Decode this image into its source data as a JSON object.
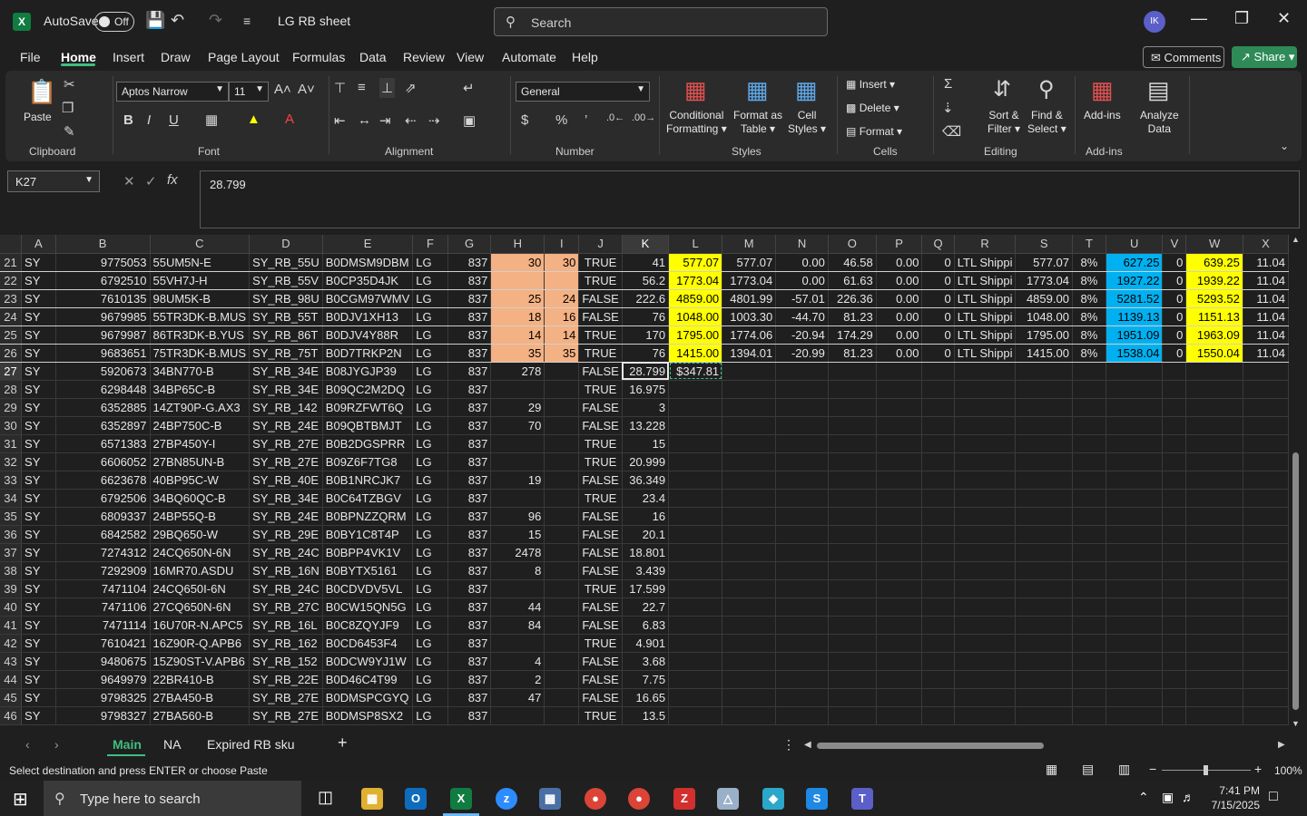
{
  "titlebar": {
    "autosave_label": "AutoSave",
    "autosave_state": "Off",
    "doc_title": "LG RB sheet",
    "search_placeholder": "Search",
    "avatar_initials": "IK"
  },
  "ribbon_tabs": [
    "File",
    "Home",
    "Insert",
    "Draw",
    "Page Layout",
    "Formulas",
    "Data",
    "Review",
    "View",
    "Automate",
    "Help"
  ],
  "active_tab": "Home",
  "buttons": {
    "comments": "Comments",
    "share": "Share"
  },
  "ribbon": {
    "clipboard": {
      "label": "Clipboard",
      "paste": "Paste"
    },
    "font": {
      "label": "Font",
      "family": "Aptos Narrow",
      "size": "11"
    },
    "alignment": {
      "label": "Alignment"
    },
    "number": {
      "label": "Number",
      "format": "General"
    },
    "styles": {
      "label": "Styles",
      "conditional": "Conditional",
      "conditional2": "Formatting",
      "format_as": "Format as",
      "format_as2": "Table",
      "cell": "Cell",
      "cell2": "Styles"
    },
    "cells": {
      "label": "Cells",
      "insert": "Insert",
      "delete": "Delete",
      "format": "Format"
    },
    "editing": {
      "label": "Editing",
      "sort": "Sort &",
      "sort2": "Filter",
      "find": "Find &",
      "find2": "Select"
    },
    "addins": {
      "label": "Add-ins",
      "addins": "Add-ins",
      "analyze": "Analyze",
      "analyze2": "Data"
    }
  },
  "formula_bar": {
    "name_box": "K27",
    "formula": "28.799"
  },
  "columns": [
    "A",
    "B",
    "C",
    "D",
    "E",
    "F",
    "G",
    "H",
    "I",
    "J",
    "K",
    "L",
    "M",
    "N",
    "O",
    "P",
    "Q",
    "R",
    "S",
    "T",
    "U",
    "V",
    "W",
    "X"
  ],
  "rows": [
    {
      "n": "21",
      "c": [
        "SY",
        "9775053",
        "55UM5N-E",
        "SY_RB_55U",
        "B0DMSM9DBM",
        "LG",
        "837",
        "30",
        "30",
        "TRUE",
        "41",
        "577.07",
        "577.07",
        "0.00",
        "46.58",
        "0.00",
        "0",
        "LTL Shippi",
        "577.07",
        "8%",
        "627.25",
        "0",
        "639.25",
        "11.04"
      ]
    },
    {
      "n": "22",
      "c": [
        "SY",
        "6792510",
        "55VH7J-H",
        "SY_RB_55V",
        "B0CP35D4JK",
        "LG",
        "837",
        "",
        "",
        "TRUE",
        "56.2",
        "1773.04",
        "1773.04",
        "0.00",
        "61.63",
        "0.00",
        "0",
        "LTL Shippi",
        "1773.04",
        "8%",
        "1927.22",
        "0",
        "1939.22",
        "11.04"
      ]
    },
    {
      "n": "23",
      "c": [
        "SY",
        "7610135",
        "98UM5K-B",
        "SY_RB_98U",
        "B0CGM97WMV",
        "LG",
        "837",
        "25",
        "24",
        "FALSE",
        "222.6",
        "4859.00",
        "4801.99",
        "-57.01",
        "226.36",
        "0.00",
        "0",
        "LTL Shippi",
        "4859.00",
        "8%",
        "5281.52",
        "0",
        "5293.52",
        "11.04"
      ]
    },
    {
      "n": "24",
      "c": [
        "SY",
        "9679985",
        "55TR3DK-B.MUS",
        "SY_RB_55T",
        "B0DJV1XH13",
        "LG",
        "837",
        "18",
        "16",
        "FALSE",
        "76",
        "1048.00",
        "1003.30",
        "-44.70",
        "81.23",
        "0.00",
        "0",
        "LTL Shippi",
        "1048.00",
        "8%",
        "1139.13",
        "0",
        "1151.13",
        "11.04"
      ]
    },
    {
      "n": "25",
      "c": [
        "SY",
        "9679987",
        "86TR3DK-B.YUS",
        "SY_RB_86T",
        "B0DJV4Y88R",
        "LG",
        "837",
        "14",
        "14",
        "TRUE",
        "170",
        "1795.00",
        "1774.06",
        "-20.94",
        "174.29",
        "0.00",
        "0",
        "LTL Shippi",
        "1795.00",
        "8%",
        "1951.09",
        "0",
        "1963.09",
        "11.04"
      ]
    },
    {
      "n": "26",
      "c": [
        "SY",
        "9683651",
        "75TR3DK-B.MUS",
        "SY_RB_75T",
        "B0D7TRKP2N",
        "LG",
        "837",
        "35",
        "35",
        "TRUE",
        "76",
        "1415.00",
        "1394.01",
        "-20.99",
        "81.23",
        "0.00",
        "0",
        "LTL Shippi",
        "1415.00",
        "8%",
        "1538.04",
        "0",
        "1550.04",
        "11.04"
      ]
    },
    {
      "n": "27",
      "c": [
        "SY",
        "5920673",
        "34BN770-B",
        "SY_RB_34E",
        "B08JYGJP39",
        "LG",
        "837",
        "278",
        "",
        "FALSE",
        "28.799",
        "$347.81",
        "",
        "",
        "",
        "",
        "",
        "",
        "",
        "",
        "",
        "",
        "",
        ""
      ]
    },
    {
      "n": "28",
      "c": [
        "SY",
        "6298448",
        "34BP65C-B",
        "SY_RB_34E",
        "B09QC2M2DQ",
        "LG",
        "837",
        "",
        "",
        "TRUE",
        "16.975",
        "",
        "",
        "",
        "",
        "",
        "",
        "",
        "",
        "",
        "",
        "",
        "",
        ""
      ]
    },
    {
      "n": "29",
      "c": [
        "SY",
        "6352885",
        "14ZT90P-G.AX3",
        "SY_RB_142",
        "B09RZFWT6Q",
        "LG",
        "837",
        "29",
        "",
        "FALSE",
        "3",
        "",
        "",
        "",
        "",
        "",
        "",
        "",
        "",
        "",
        "",
        "",
        "",
        ""
      ]
    },
    {
      "n": "30",
      "c": [
        "SY",
        "6352897",
        "24BP750C-B",
        "SY_RB_24E",
        "B09QBTBMJT",
        "LG",
        "837",
        "70",
        "",
        "FALSE",
        "13.228",
        "",
        "",
        "",
        "",
        "",
        "",
        "",
        "",
        "",
        "",
        "",
        "",
        ""
      ]
    },
    {
      "n": "31",
      "c": [
        "SY",
        "6571383",
        "27BP450Y-I",
        "SY_RB_27E",
        "B0B2DGSPRR",
        "LG",
        "837",
        "",
        "",
        "TRUE",
        "15",
        "",
        "",
        "",
        "",
        "",
        "",
        "",
        "",
        "",
        "",
        "",
        "",
        ""
      ]
    },
    {
      "n": "32",
      "c": [
        "SY",
        "6606052",
        "27BN85UN-B",
        "SY_RB_27E",
        "B09Z6F7TG8",
        "LG",
        "837",
        "",
        "",
        "TRUE",
        "20.999",
        "",
        "",
        "",
        "",
        "",
        "",
        "",
        "",
        "",
        "",
        "",
        "",
        ""
      ]
    },
    {
      "n": "33",
      "c": [
        "SY",
        "6623678",
        "40BP95C-W",
        "SY_RB_40E",
        "B0B1NRCJK7",
        "LG",
        "837",
        "19",
        "",
        "FALSE",
        "36.349",
        "",
        "",
        "",
        "",
        "",
        "",
        "",
        "",
        "",
        "",
        "",
        "",
        ""
      ]
    },
    {
      "n": "34",
      "c": [
        "SY",
        "6792506",
        "34BQ60QC-B",
        "SY_RB_34E",
        "B0C64TZBGV",
        "LG",
        "837",
        "",
        "",
        "TRUE",
        "23.4",
        "",
        "",
        "",
        "",
        "",
        "",
        "",
        "",
        "",
        "",
        "",
        "",
        ""
      ]
    },
    {
      "n": "35",
      "c": [
        "SY",
        "6809337",
        "24BP55Q-B",
        "SY_RB_24E",
        "B0BPNZZQRM",
        "LG",
        "837",
        "96",
        "",
        "FALSE",
        "16",
        "",
        "",
        "",
        "",
        "",
        "",
        "",
        "",
        "",
        "",
        "",
        "",
        ""
      ]
    },
    {
      "n": "36",
      "c": [
        "SY",
        "6842582",
        "29BQ650-W",
        "SY_RB_29E",
        "B0BY1C8T4P",
        "LG",
        "837",
        "15",
        "",
        "FALSE",
        "20.1",
        "",
        "",
        "",
        "",
        "",
        "",
        "",
        "",
        "",
        "",
        "",
        "",
        ""
      ]
    },
    {
      "n": "37",
      "c": [
        "SY",
        "7274312",
        "24CQ650N-6N",
        "SY_RB_24C",
        "B0BPP4VK1V",
        "LG",
        "837",
        "2478",
        "",
        "FALSE",
        "18.801",
        "",
        "",
        "",
        "",
        "",
        "",
        "",
        "",
        "",
        "",
        "",
        "",
        ""
      ]
    },
    {
      "n": "38",
      "c": [
        "SY",
        "7292909",
        "16MR70.ASDU",
        "SY_RB_16N",
        "B0BYTX5161",
        "LG",
        "837",
        "8",
        "",
        "FALSE",
        "3.439",
        "",
        "",
        "",
        "",
        "",
        "",
        "",
        "",
        "",
        "",
        "",
        "",
        ""
      ]
    },
    {
      "n": "39",
      "c": [
        "SY",
        "7471104",
        "24CQ650I-6N",
        "SY_RB_24C",
        "B0CDVDV5VL",
        "LG",
        "837",
        "",
        "",
        "TRUE",
        "17.599",
        "",
        "",
        "",
        "",
        "",
        "",
        "",
        "",
        "",
        "",
        "",
        "",
        ""
      ]
    },
    {
      "n": "40",
      "c": [
        "SY",
        "7471106",
        "27CQ650N-6N",
        "SY_RB_27C",
        "B0CW15QN5G",
        "LG",
        "837",
        "44",
        "",
        "FALSE",
        "22.7",
        "",
        "",
        "",
        "",
        "",
        "",
        "",
        "",
        "",
        "",
        "",
        "",
        ""
      ]
    },
    {
      "n": "41",
      "c": [
        "SY",
        "7471114",
        "16U70R-N.APC5",
        "SY_RB_16L",
        "B0C8ZQYJF9",
        "LG",
        "837",
        "84",
        "",
        "FALSE",
        "6.83",
        "",
        "",
        "",
        "",
        "",
        "",
        "",
        "",
        "",
        "",
        "",
        "",
        ""
      ]
    },
    {
      "n": "42",
      "c": [
        "SY",
        "7610421",
        "16Z90R-Q.APB6",
        "SY_RB_162",
        "B0CD6453F4",
        "LG",
        "837",
        "",
        "",
        "TRUE",
        "4.901",
        "",
        "",
        "",
        "",
        "",
        "",
        "",
        "",
        "",
        "",
        "",
        "",
        ""
      ]
    },
    {
      "n": "43",
      "c": [
        "SY",
        "9480675",
        "15Z90ST-V.APB6",
        "SY_RB_152",
        "B0DCW9YJ1W",
        "LG",
        "837",
        "4",
        "",
        "FALSE",
        "3.68",
        "",
        "",
        "",
        "",
        "",
        "",
        "",
        "",
        "",
        "",
        "",
        "",
        ""
      ]
    },
    {
      "n": "44",
      "c": [
        "SY",
        "9649979",
        "22BR410-B",
        "SY_RB_22E",
        "B0D46C4T99",
        "LG",
        "837",
        "2",
        "",
        "FALSE",
        "7.75",
        "",
        "",
        "",
        "",
        "",
        "",
        "",
        "",
        "",
        "",
        "",
        "",
        ""
      ]
    },
    {
      "n": "45",
      "c": [
        "SY",
        "9798325",
        "27BA450-B",
        "SY_RB_27E",
        "B0DMSPCGYQ",
        "LG",
        "837",
        "47",
        "",
        "FALSE",
        "16.65",
        "",
        "",
        "",
        "",
        "",
        "",
        "",
        "",
        "",
        "",
        "",
        "",
        ""
      ]
    },
    {
      "n": "46",
      "c": [
        "SY",
        "9798327",
        "27BA560-B",
        "SY_RB_27E",
        "B0DMSP8SX2",
        "LG",
        "837",
        "",
        "",
        "TRUE",
        "13.5",
        "",
        "",
        "",
        "",
        "",
        "",
        "",
        "",
        "",
        "",
        "",
        "",
        ""
      ]
    }
  ],
  "sheets": [
    "Main",
    "NA",
    "Expired RB sku"
  ],
  "active_sheet": "Main",
  "status": {
    "message": "Select destination and press ENTER or choose Paste",
    "zoom": "100%"
  },
  "taskbar": {
    "search_placeholder": "Type here to search",
    "time": "7:41 PM",
    "date": "7/15/2025"
  },
  "colors": {
    "accent": "#107c41",
    "peach": "#f4b183",
    "yellow": "#ffff00",
    "blue": "#00b0f0"
  }
}
